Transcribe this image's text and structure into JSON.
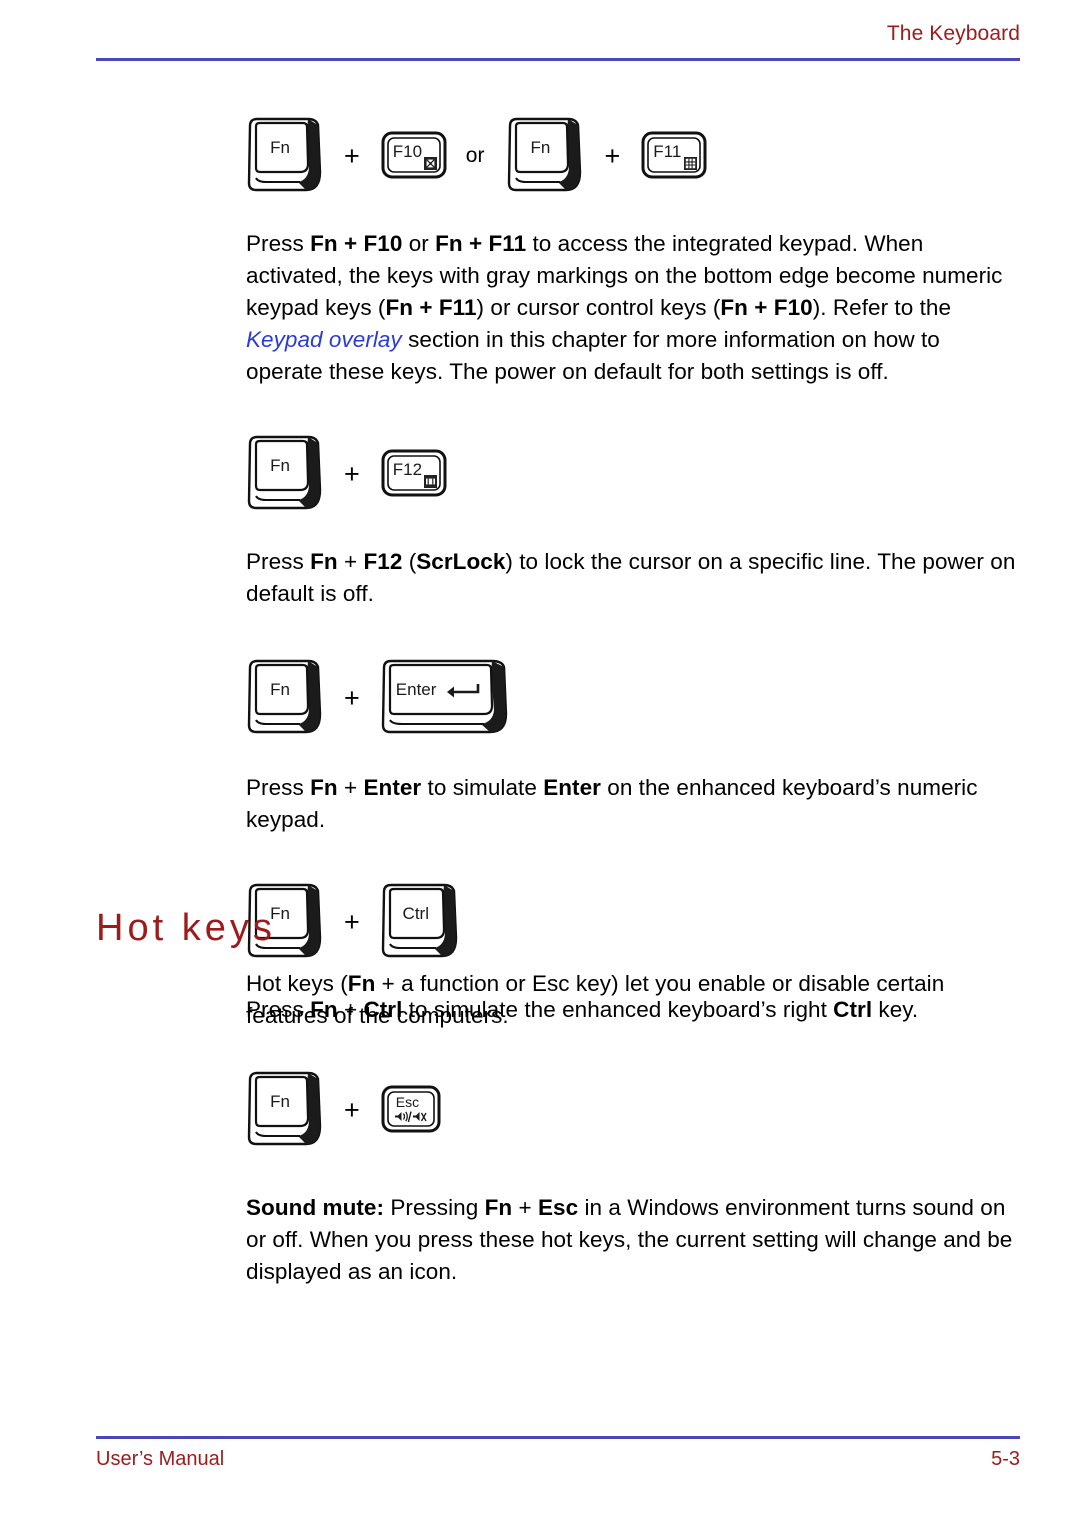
{
  "header": {
    "title": "The Keyboard",
    "rule_color": "#4a47b8",
    "text_color": "#9e1b1b"
  },
  "footer": {
    "manual_label": "User’s Manual",
    "page_number": "5-3",
    "rule_color": "#4a47b8",
    "text_color": "#9e1b1b"
  },
  "figures": {
    "fn_f10_f11": {
      "keys": [
        {
          "name": "Fn",
          "label": "Fn",
          "style": "3d"
        },
        {
          "name": "plus",
          "label": "+",
          "style": "operator"
        },
        {
          "name": "F10",
          "label": "F10",
          "style": "flat",
          "icon": "cursor-control-overlay-icon"
        },
        {
          "name": "or",
          "label": "or",
          "style": "operator"
        },
        {
          "name": "Fn",
          "label": "Fn",
          "style": "3d"
        },
        {
          "name": "plus",
          "label": "+",
          "style": "operator"
        },
        {
          "name": "F11",
          "label": "F11",
          "style": "flat",
          "icon": "numeric-keypad-overlay-icon"
        }
      ]
    },
    "fn_f12": {
      "keys": [
        {
          "name": "Fn",
          "label": "Fn",
          "style": "3d"
        },
        {
          "name": "plus",
          "label": "+",
          "style": "operator"
        },
        {
          "name": "F12",
          "label": "F12",
          "style": "flat",
          "icon": "scroll-lock-icon"
        }
      ]
    },
    "fn_enter": {
      "keys": [
        {
          "name": "Fn",
          "label": "Fn",
          "style": "3d"
        },
        {
          "name": "plus",
          "label": "+",
          "style": "operator"
        },
        {
          "name": "Enter",
          "label": "Enter",
          "style": "3d-wide",
          "icon": "enter-arrow-icon"
        }
      ]
    },
    "fn_ctrl": {
      "keys": [
        {
          "name": "Fn",
          "label": "Fn",
          "style": "3d"
        },
        {
          "name": "plus",
          "label": "+",
          "style": "operator"
        },
        {
          "name": "Ctrl",
          "label": "Ctrl",
          "style": "3d"
        }
      ]
    },
    "fn_esc": {
      "keys": [
        {
          "name": "Fn",
          "label": "Fn",
          "style": "3d"
        },
        {
          "name": "plus",
          "label": "+",
          "style": "operator"
        },
        {
          "name": "Esc",
          "label": "Esc",
          "style": "flat",
          "icon": "sound-mute-speaker-icon"
        }
      ]
    }
  },
  "paragraphs": {
    "keypad": {
      "t1": "Press ",
      "b1": "Fn + F10",
      "t2": " or ",
      "b2": "Fn + F11",
      "t3": " to access the integrated keypad. When activated, the keys with gray markings on the bottom edge become numeric keypad keys (",
      "b3": "Fn + F11",
      "t4": ") or cursor control keys (",
      "b4": "Fn + F10",
      "t5": "). Refer to the ",
      "xref": "Keypad overlay",
      "t6": " section in this chapter for more information on how to operate these keys. The power on default for both settings is off."
    },
    "scrlock": {
      "t1": "Press ",
      "b1": "Fn",
      "op": " + ",
      "b2": "F12",
      "t2": " (",
      "b3": "ScrLock",
      "t3": ") to lock the cursor on a specific line. The power on default is off."
    },
    "enter": {
      "t1": "Press ",
      "b1": "Fn",
      "op": " + ",
      "b2": "Enter",
      "t2": " to simulate ",
      "b3": "Enter",
      "t3": " on the enhanced keyboard’s numeric keypad."
    },
    "ctrl": {
      "t1": "Press ",
      "b1": "Fn",
      "op": " + ",
      "b2": "Ctrl",
      "t2": " to simulate the enhanced keyboard’s right ",
      "b3": "Ctrl",
      "t3": " key."
    },
    "hotkeys_intro": {
      "t1": "Hot keys (",
      "b1": "Fn",
      "t2": " + a function or Esc key) let you enable or disable certain features of the computers."
    },
    "sound_mute": {
      "b1": "Sound mute:",
      "t1": " Pressing ",
      "b2": "Fn",
      "op": " + ",
      "b3": "Esc",
      "t2": " in a Windows environment turns sound on or off. When you press these hot keys, the current setting will change and be displayed as an icon."
    }
  },
  "headings": {
    "hot_keys": "Hot keys"
  }
}
